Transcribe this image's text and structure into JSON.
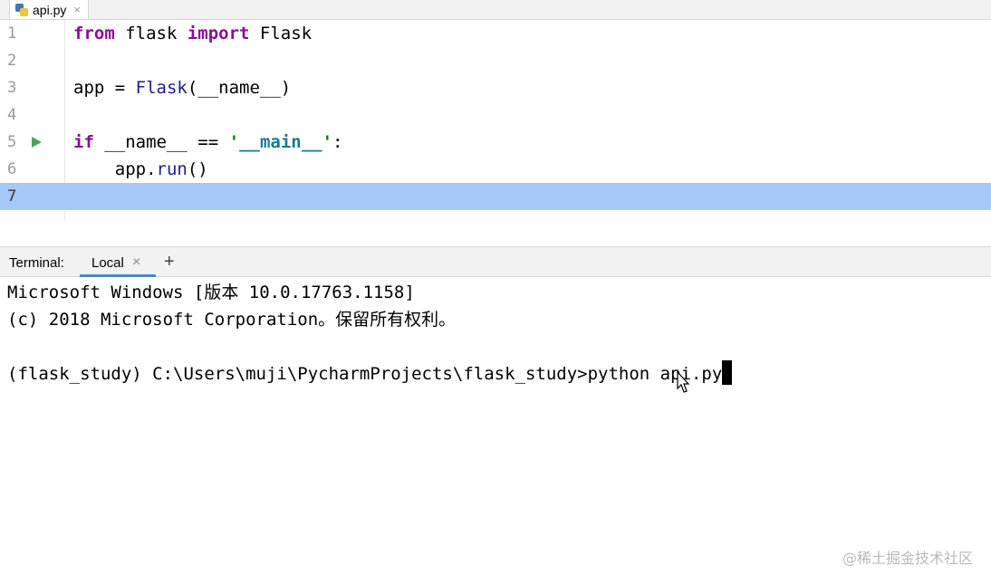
{
  "editor": {
    "tab": {
      "filename": "api.py",
      "icon": "python-file-icon",
      "close": "×"
    },
    "lines": [
      {
        "num": "1"
      },
      {
        "num": "2"
      },
      {
        "num": "3"
      },
      {
        "num": "4"
      },
      {
        "num": "5"
      },
      {
        "num": "6"
      },
      {
        "num": "7"
      }
    ],
    "code": {
      "l1_from": "from",
      "l1_mod": " flask ",
      "l1_import": "import",
      "l1_name": " Flask",
      "l3_app": "app = ",
      "l3_flask": "Flask",
      "l3_rest": "(__name__)",
      "l5_if": "if",
      "l5_mid": " __name__ == ",
      "l5_str_q1": "'",
      "l5_str": "__main__",
      "l5_str_q2": "'",
      "l5_colon": ":",
      "l6_indent": "    app.",
      "l6_run": "run",
      "l6_rest": "()"
    },
    "current_line": "7",
    "colors": {
      "current_line_bg": "#a6c8f7",
      "run_icon": "#4aa55a"
    }
  },
  "terminal": {
    "label": "Terminal:",
    "tab_local": "Local",
    "tab_close": "×",
    "new_tab": "+",
    "lines": [
      "Microsoft Windows [版本 10.0.17763.1158]",
      "(c) 2018 Microsoft Corporation。保留所有权利。",
      "",
      "(flask_study) C:\\Users\\muji\\PycharmProjects\\flask_study>python api.py"
    ]
  },
  "watermark": "@稀土掘金技术社区"
}
